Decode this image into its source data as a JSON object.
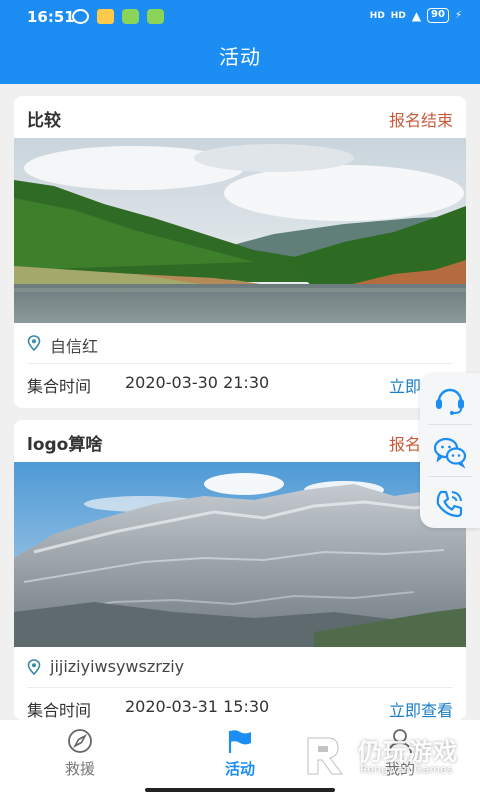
{
  "status_bar": {
    "time": "16:51",
    "signal_1": "HD",
    "signal_2": "HD",
    "battery": "90"
  },
  "header": {
    "title": "活动"
  },
  "activities": [
    {
      "title": "比较",
      "status": "报名结束",
      "location": "自信红",
      "time_label": "集合时间",
      "time_value": "2020-03-30 21:30",
      "action": "立即查看"
    },
    {
      "title": "logo算啥",
      "status": "报名结束",
      "location": "jijiziyiwsywszrziy",
      "time_label": "集合时间",
      "time_value": "2020-03-31 15:30",
      "action": "立即查看"
    }
  ],
  "float_panel": {
    "items": [
      "headset-icon",
      "wechat-icon",
      "phone-icon"
    ]
  },
  "tabbar": {
    "items": [
      {
        "label": "救援",
        "icon": "compass-icon"
      },
      {
        "label": "活动",
        "icon": "flag-icon",
        "active": true
      },
      {
        "label": "我的",
        "icon": "user-icon"
      }
    ]
  },
  "watermark": {
    "name": "仍玩游戏",
    "sub": "Rengwan Games"
  },
  "colors": {
    "primary": "#1c8ef3",
    "status_ended": "#c75b3a",
    "link": "#1a7ec8"
  }
}
